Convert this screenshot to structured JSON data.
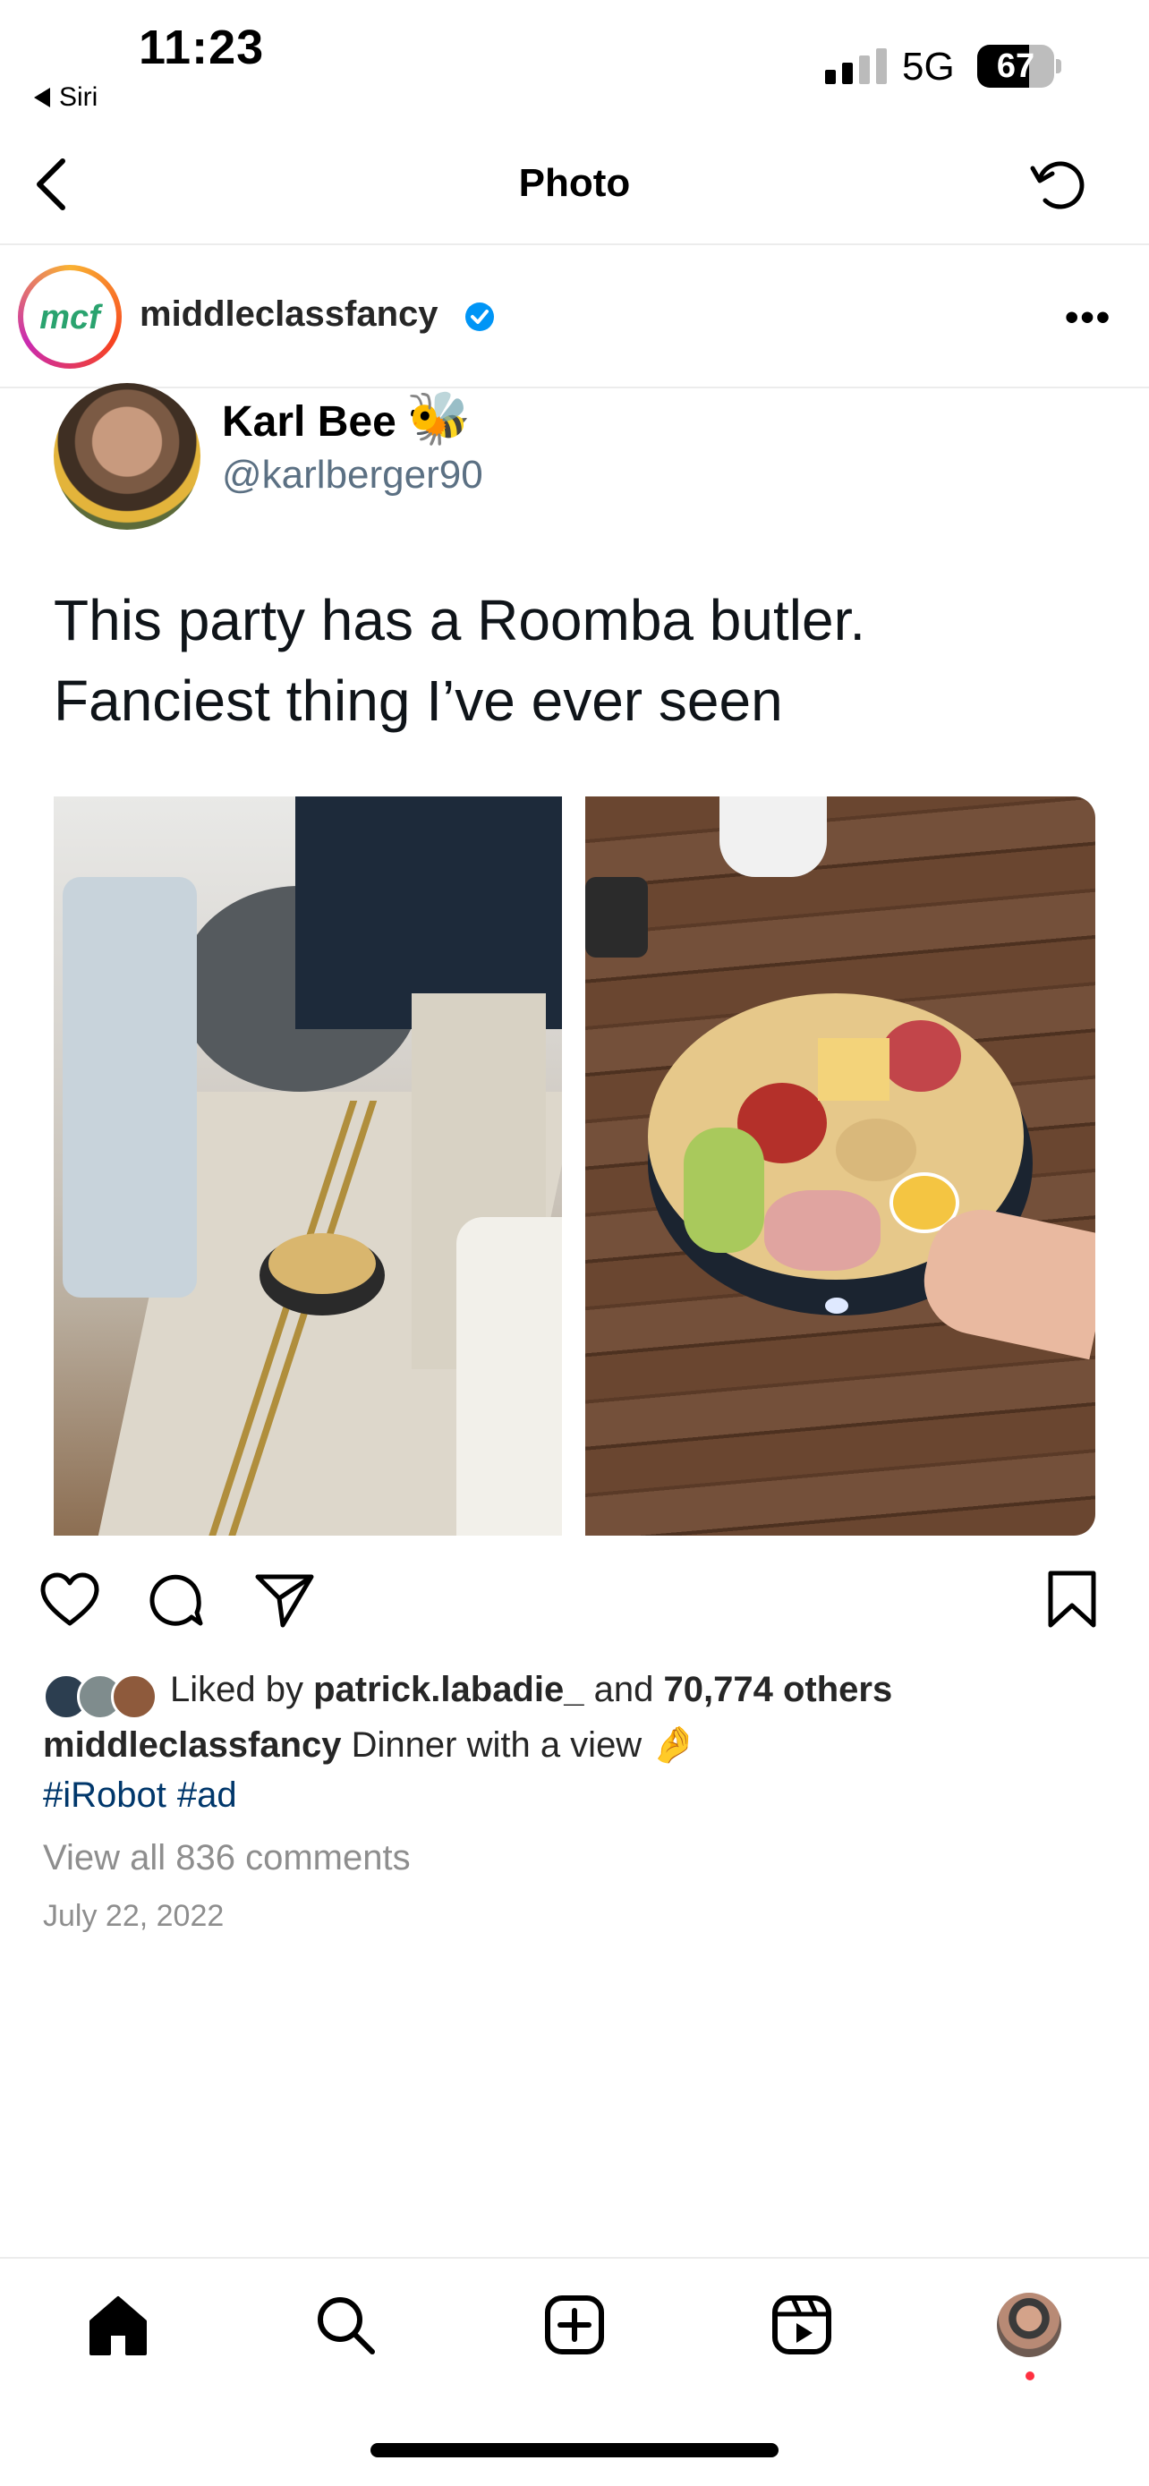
{
  "status_bar": {
    "time": "11:23",
    "back_app": "Siri",
    "network": "5G",
    "battery": "67",
    "battery_level": 0.67,
    "signal_bars": 2
  },
  "header": {
    "title": "Photo"
  },
  "post": {
    "username": "middleclassfancy",
    "avatar_text": "mcf",
    "verified": true,
    "more_label": "•••",
    "embedded_tweet": {
      "name": "Karl Bee",
      "name_emoji": "🐝",
      "handle": "@karlberger90",
      "text_line1": "This party has a Roomba butler.",
      "text_line2": "Fanciest thing I’ve ever seen"
    },
    "liked_by_prefix": "Liked by",
    "liked_by_user": "patrick.labadie_",
    "liked_by_and": "and",
    "liked_by_others": "70,774 others",
    "caption_user": "middleclassfancy",
    "caption_text": "Dinner with a view",
    "caption_emoji": "🤌",
    "hashtags": [
      "#iRobot",
      "#ad"
    ],
    "view_all_comments": "View all 836 comments",
    "date": "July 22, 2022"
  },
  "icons": {
    "back": "chevron-left-icon",
    "refresh": "refresh-icon",
    "like": "heart-icon",
    "comment": "comment-icon",
    "share": "send-icon",
    "save": "bookmark-icon",
    "tabs": [
      "home-icon",
      "search-icon",
      "create-icon",
      "reels-icon",
      "profile-avatar"
    ]
  },
  "colors": {
    "verified_blue": "#0095f6",
    "hashtag": "#00376b",
    "secondary_text": "#8e8e8e",
    "notification_dot": "#ff3040"
  }
}
